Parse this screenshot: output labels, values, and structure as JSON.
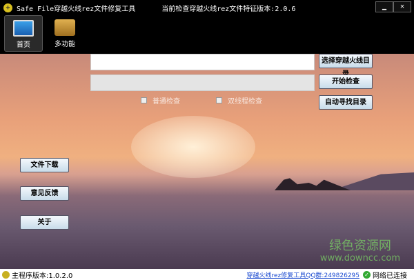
{
  "title": "Safe  File穿越火线rez文件修复工具",
  "feature_version": "当前检查穿越火线rez文件特征版本:2.0.6",
  "window_buttons": {
    "minimize": "▁",
    "close": "✕"
  },
  "toolbar": [
    {
      "label": "首页",
      "icon": "monitor-icon",
      "active": true
    },
    {
      "label": "多功能",
      "icon": "toolbox-icon",
      "active": false
    }
  ],
  "main": {
    "path_input": {
      "value": "",
      "placeholder": ""
    },
    "progress_value": 0,
    "buttons_right": [
      "选择穿越火线目录",
      "开始检查",
      "自动寻找目录"
    ],
    "checkboxes": [
      {
        "label": "普通检查",
        "checked": false
      },
      {
        "label": "双线程检查",
        "checked": false
      }
    ],
    "buttons_left": [
      "文件下载",
      "意见反馈",
      "关于"
    ]
  },
  "watermark": {
    "cn": "绿色资源网",
    "url": "www.downcc.com"
  },
  "status": {
    "version": "主程序版本:1.0.2.0",
    "qq_link": "穿越火线rez修复工具QQ群:249826295",
    "network": "网络已连接"
  }
}
